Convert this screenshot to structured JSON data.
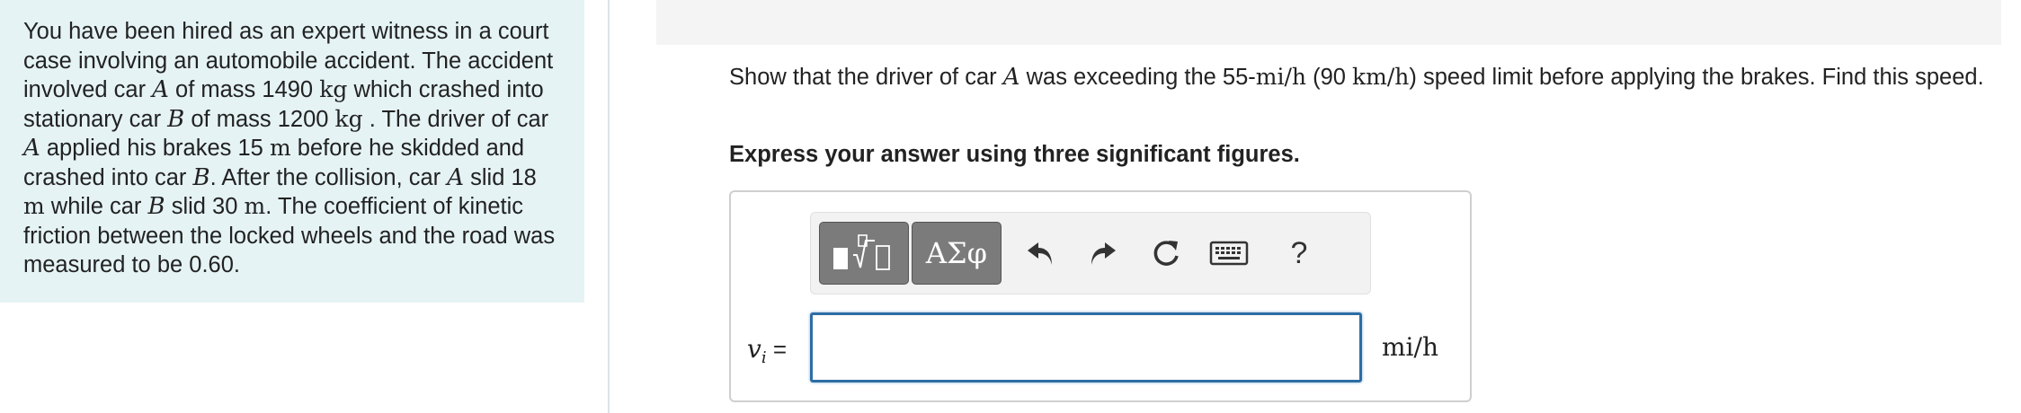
{
  "problem": {
    "t1": "You have been hired as an expert witness in a court case involving an automobile accident. The accident involved car ",
    "car_a": "A",
    "t2": " of mass 1490 ",
    "kg1": "kg",
    "t3": " which crashed into stationary car ",
    "car_b": "B",
    "t4": " of mass 1200 ",
    "kg2": "kg",
    "t5": " . The driver of car ",
    "car_a2": "A",
    "t6": " applied his brakes 15 ",
    "m1": "m",
    "t7": " before he skidded and crashed into car ",
    "car_b2": "B",
    "t8": ". After the collision, car ",
    "car_a3": "A",
    "t9": " slid 18 ",
    "m2": "m",
    "t10": " while car ",
    "car_b3": "B",
    "t11": " slid 30 ",
    "m3": "m",
    "t12": ". The coefficient of kinetic friction between the locked wheels and the road was measured to be 0.60."
  },
  "question": {
    "t1": "Show that the driver of car ",
    "car": "A",
    "t2": " was exceeding the 55-",
    "unit1": "mi/h",
    "t3": " (90 ",
    "unit2": "km/h",
    "t4": ") speed limit before applying the brakes. Find this speed."
  },
  "instruction": "Express your answer using three significant figures.",
  "answer": {
    "var_symbol": "v",
    "var_sub": "i",
    "equals": " =",
    "input_value": "",
    "unit": "mi/h"
  },
  "toolbar": {
    "greek_label": "ΑΣφ",
    "help_label": "?",
    "icons": [
      "templates-icon",
      "greek-letters",
      "undo-icon",
      "redo-icon",
      "reset-icon",
      "keyboard-icon",
      "help-icon"
    ]
  },
  "colors": {
    "problem_bg": "#e5f3f5",
    "input_border": "#2e6da4",
    "toolbar_btn": "#7b7b7b"
  }
}
